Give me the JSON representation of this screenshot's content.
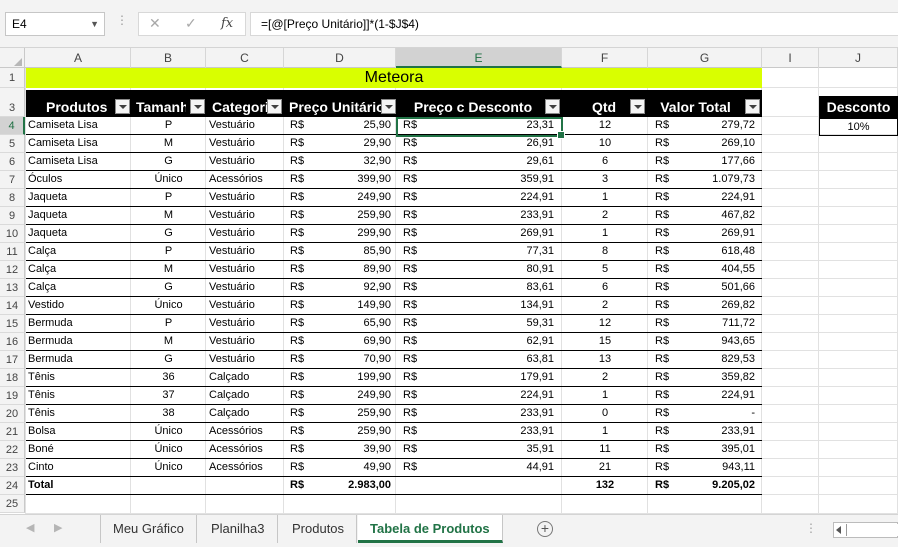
{
  "formula_bar": {
    "name_box": "E4",
    "formula": "=[@[Preço Unitário]]*(1-$J$4)"
  },
  "columns": [
    "A",
    "B",
    "C",
    "D",
    "E",
    "F",
    "G",
    "I",
    "J"
  ],
  "row_numbers": [
    "1",
    "3",
    "4",
    "5",
    "6",
    "7",
    "8",
    "9",
    "10",
    "11",
    "12",
    "13",
    "14",
    "15",
    "16",
    "17",
    "18",
    "19",
    "20",
    "21",
    "22",
    "23",
    "24",
    "25"
  ],
  "title": "Meteora",
  "headers": [
    "Produtos",
    "Tamanho",
    "Categoria",
    "Preço Unitário",
    "Preço c Desconto",
    "Qtd",
    "Valor Total"
  ],
  "currency": "R$",
  "rows": [
    [
      "Camiseta Lisa",
      "P",
      "Vestuário",
      "25,90",
      "23,31",
      "12",
      "279,72"
    ],
    [
      "Camiseta Lisa",
      "M",
      "Vestuário",
      "29,90",
      "26,91",
      "10",
      "269,10"
    ],
    [
      "Camiseta Lisa",
      "G",
      "Vestuário",
      "32,90",
      "29,61",
      "6",
      "177,66"
    ],
    [
      "Óculos",
      "Único",
      "Acessórios",
      "399,90",
      "359,91",
      "3",
      "1.079,73"
    ],
    [
      "Jaqueta",
      "P",
      "Vestuário",
      "249,90",
      "224,91",
      "1",
      "224,91"
    ],
    [
      "Jaqueta",
      "M",
      "Vestuário",
      "259,90",
      "233,91",
      "2",
      "467,82"
    ],
    [
      "Jaqueta",
      "G",
      "Vestuário",
      "299,90",
      "269,91",
      "1",
      "269,91"
    ],
    [
      "Calça",
      "P",
      "Vestuário",
      "85,90",
      "77,31",
      "8",
      "618,48"
    ],
    [
      "Calça",
      "M",
      "Vestuário",
      "89,90",
      "80,91",
      "5",
      "404,55"
    ],
    [
      "Calça",
      "G",
      "Vestuário",
      "92,90",
      "83,61",
      "6",
      "501,66"
    ],
    [
      "Vestido",
      "Único",
      "Vestuário",
      "149,90",
      "134,91",
      "2",
      "269,82"
    ],
    [
      "Bermuda",
      "P",
      "Vestuário",
      "65,90",
      "59,31",
      "12",
      "711,72"
    ],
    [
      "Bermuda",
      "M",
      "Vestuário",
      "69,90",
      "62,91",
      "15",
      "943,65"
    ],
    [
      "Bermuda",
      "G",
      "Vestuário",
      "70,90",
      "63,81",
      "13",
      "829,53"
    ],
    [
      "Tênis",
      "36",
      "Calçado",
      "199,90",
      "179,91",
      "2",
      "359,82"
    ],
    [
      "Tênis",
      "37",
      "Calçado",
      "249,90",
      "224,91",
      "1",
      "224,91"
    ],
    [
      "Tênis",
      "38",
      "Calçado",
      "259,90",
      "233,91",
      "0",
      "-"
    ],
    [
      "Bolsa",
      "Único",
      "Acessórios",
      "259,90",
      "233,91",
      "1",
      "233,91"
    ],
    [
      "Boné",
      "Único",
      "Acessórios",
      "39,90",
      "35,91",
      "11",
      "395,01"
    ],
    [
      "Cinto",
      "Único",
      "Acessórios",
      "49,90",
      "44,91",
      "21",
      "943,11"
    ]
  ],
  "total": {
    "label": "Total",
    "preco_unitario": "2.983,00",
    "qtd": "132",
    "valor_total": "9.205,02"
  },
  "discount": {
    "label": "Desconto",
    "value": "10%"
  },
  "sheet_tabs": [
    "Meu Gráfico",
    "Planilha3",
    "Produtos",
    "Tabela de Produtos"
  ],
  "active_sheet_index": 3,
  "colors": {
    "title_fill": "#d9ff00",
    "header_fill": "#000000",
    "excel_green": "#217346"
  }
}
